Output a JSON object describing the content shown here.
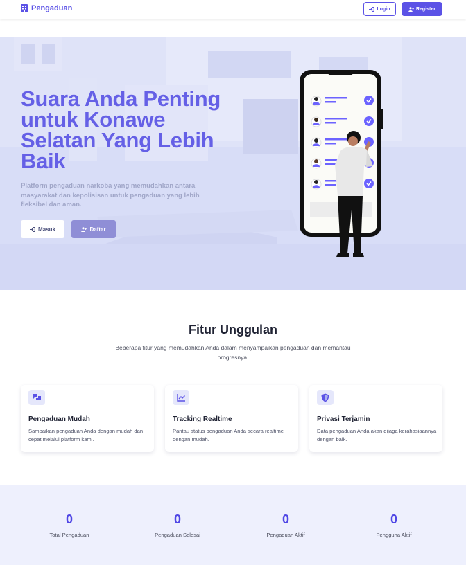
{
  "navbar": {
    "brand": "Pengaduan",
    "login_label": "Login",
    "register_label": "Register"
  },
  "hero": {
    "title": "Suara Anda Penting untuk Konawe Selatan Yang Lebih Baik",
    "description": "Platform pengaduan narkoba yang memudahkan antara masyarakat dan kepolisisan untuk pengaduan yang lebih fleksibel dan aman.",
    "masuk_label": "Masuk",
    "daftar_label": "Daftar"
  },
  "features": {
    "title": "Fitur Unggulan",
    "subtitle": "Beberapa fitur yang memudahkan Anda dalam menyampaikan pengaduan dan memantau progresnya.",
    "items": [
      {
        "icon": "chat-bubbles-icon",
        "title": "Pengaduan Mudah",
        "description": "Sampaikan pengaduan Anda dengan mudah dan cepat melalui platform kami."
      },
      {
        "icon": "chart-line-icon",
        "title": "Tracking Realtime",
        "description": "Pantau status pengaduan Anda secara realtime dengan mudah."
      },
      {
        "icon": "shield-icon",
        "title": "Privasi Terjamin",
        "description": "Data pengaduan Anda akan dijaga kerahasiaannya dengan baik."
      }
    ]
  },
  "stats": [
    {
      "value": "0",
      "label": "Total Pengaduan"
    },
    {
      "value": "0",
      "label": "Pengaduan Selesai"
    },
    {
      "value": "0",
      "label": "Pengaduan Aktif"
    },
    {
      "value": "0",
      "label": "Pengguna Aktif"
    }
  ],
  "colors": {
    "accent": "#5b52e6",
    "hero_title": "#6560e6",
    "hero_bg": "#d7dcf6",
    "stats_bg": "#eef0fd"
  }
}
